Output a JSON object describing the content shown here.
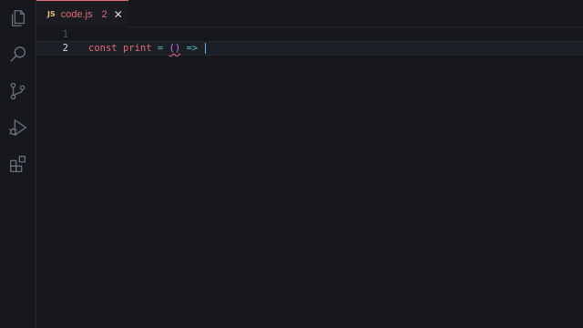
{
  "activity_bar": {
    "items": [
      {
        "name": "explorer-icon"
      },
      {
        "name": "search-icon"
      },
      {
        "name": "source-control-icon"
      },
      {
        "name": "run-debug-icon"
      },
      {
        "name": "extensions-icon"
      }
    ]
  },
  "tabs": [
    {
      "icon_label": "JS",
      "filename": "code.js",
      "problems_count": "2",
      "close_glyph": "✕"
    }
  ],
  "editor": {
    "lines": [
      {
        "number": "1",
        "tokens": []
      },
      {
        "number": "2",
        "tokens": {
          "keyword": "const",
          "identifier": "print",
          "assign": "=",
          "parens": "()",
          "arrow": "=>"
        }
      }
    ]
  },
  "colors": {
    "background": "#16181d",
    "tab_accent": "#e06c75",
    "keyword": "#e06c75",
    "operator": "#56b6c2",
    "paren": "#c678dd",
    "cursor": "#61afef",
    "js_icon": "#e5c07b"
  }
}
